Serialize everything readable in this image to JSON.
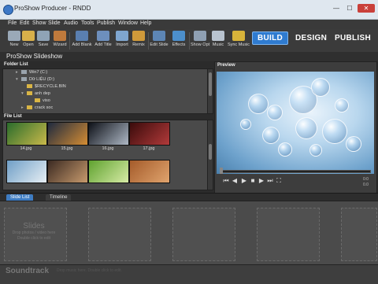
{
  "window": {
    "title": "ProShow Producer - RNDD",
    "minimize": "—",
    "maximize": "☐",
    "close": "✕"
  },
  "menu": [
    "File",
    "Edit",
    "Show",
    "Slide",
    "Audio",
    "Tools",
    "Publish",
    "Window",
    "Help"
  ],
  "toolbar": {
    "tools": [
      {
        "label": "New",
        "icon": "new-icon",
        "color": "#9aa9b8"
      },
      {
        "label": "Open",
        "icon": "open-folder-icon",
        "color": "#d8b04a"
      },
      {
        "label": "Save",
        "icon": "save-icon",
        "color": "#8fa3b6"
      },
      {
        "label": "Wizard",
        "icon": "wizard-icon",
        "color": "#c07a3c"
      },
      {
        "label": "Add Blank",
        "icon": "add-blank-icon",
        "color": "#5a7fb0"
      },
      {
        "label": "Add Title",
        "icon": "add-title-icon",
        "color": "#6d8fbd"
      },
      {
        "label": "Import",
        "icon": "import-icon",
        "color": "#7fa6cf"
      },
      {
        "label": "Remix",
        "icon": "remix-icon",
        "color": "#d09a3a"
      },
      {
        "label": "Edit Slide",
        "icon": "edit-slide-icon",
        "color": "#5d86b5"
      },
      {
        "label": "Effects",
        "icon": "effects-icon",
        "color": "#4c8fcc"
      },
      {
        "label": "Show Opt",
        "icon": "show-options-icon",
        "color": "#8fa0b3"
      },
      {
        "label": "Music",
        "icon": "music-icon",
        "color": "#b8c3cf"
      },
      {
        "label": "Sync Music",
        "icon": "sync-music-icon",
        "color": "#d8b43a"
      }
    ],
    "modes": {
      "build": "BUILD",
      "design": "DESIGN",
      "publish": "PUBLISH"
    }
  },
  "project_title": "ProShow Slideshow",
  "folder_list": {
    "title": "Folder List",
    "items": [
      {
        "label": "Win7 (C:)",
        "type": "drive",
        "expanded": false
      },
      {
        "label": "Dữ LIỆU (D:)",
        "type": "drive",
        "expanded": true
      },
      {
        "label": "$RECYCLE.BIN",
        "type": "folder",
        "expanded": false
      },
      {
        "label": "anh dep",
        "type": "folder",
        "expanded": true
      },
      {
        "label": "viso",
        "type": "folder",
        "expanded": false
      },
      {
        "label": "crack soc",
        "type": "folder",
        "expanded": false
      }
    ]
  },
  "file_list": {
    "title": "File List",
    "files": [
      {
        "name": "14.jpg",
        "colors": [
          "#2a6c2c",
          "#c9b94a"
        ]
      },
      {
        "name": "15.jpg",
        "colors": [
          "#1e2a3f",
          "#d58d34"
        ]
      },
      {
        "name": "16.jpg",
        "colors": [
          "#0e1118",
          "#aeb8c5"
        ]
      },
      {
        "name": "17.jpg",
        "colors": [
          "#3a0b0b",
          "#b23a3a"
        ]
      },
      {
        "name": "",
        "colors": [
          "#6f9fc7",
          "#e7eef3"
        ]
      },
      {
        "name": "",
        "colors": [
          "#3b2a22",
          "#c79a6d"
        ]
      },
      {
        "name": "",
        "colors": [
          "#5fa22f",
          "#d7eba6"
        ]
      },
      {
        "name": "",
        "colors": [
          "#a45b2a",
          "#e0a46e"
        ]
      }
    ]
  },
  "preview": {
    "title": "Preview",
    "controls": [
      {
        "name": "skip-back",
        "glyph": "⏮"
      },
      {
        "name": "rewind",
        "glyph": "◀"
      },
      {
        "name": "play",
        "glyph": "▶"
      },
      {
        "name": "stop",
        "glyph": "■"
      },
      {
        "name": "forward",
        "glyph": "▶"
      },
      {
        "name": "skip-forward",
        "glyph": "⏭"
      },
      {
        "name": "fullscreen",
        "glyph": "⛶"
      }
    ],
    "time_top": "0:0",
    "time_bottom": "0.0"
  },
  "bottom_tabs": [
    "Slide List",
    "Timeline"
  ],
  "slide_list": {
    "hint_title": "Slides",
    "hint_line1": "Drop photos / video here",
    "hint_line2": "Double click to edit"
  },
  "soundtrack": {
    "label": "Soundtrack",
    "hint": "Drop music here. Double click to edit."
  }
}
